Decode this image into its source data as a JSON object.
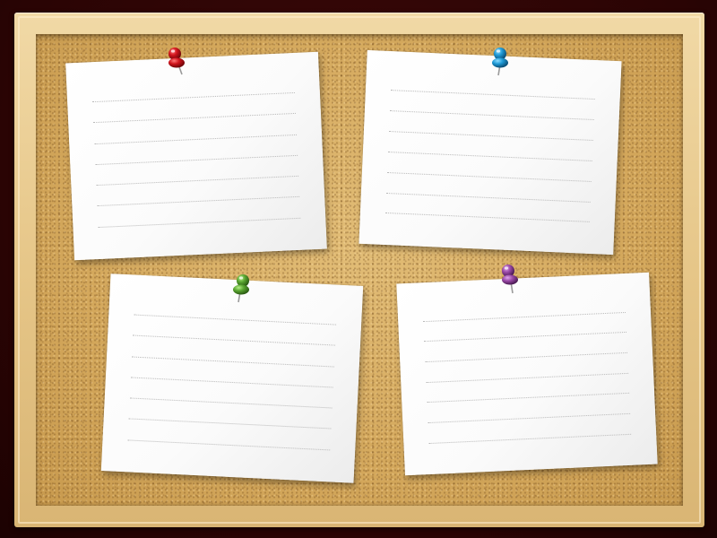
{
  "board": {
    "background_color": "#2a0505",
    "frame_color": "#e6c688",
    "cork_color": "#d7ab5f"
  },
  "notes": [
    {
      "pin_icon": "red-pushpin-icon",
      "pin_color": "#d0141c",
      "lines": 7
    },
    {
      "pin_icon": "blue-pushpin-icon",
      "pin_color": "#1f9ad6",
      "lines": 7
    },
    {
      "pin_icon": "green-pushpin-icon",
      "pin_color": "#5aa632",
      "lines": 7
    },
    {
      "pin_icon": "purple-pushpin-icon",
      "pin_color": "#9b4aa8",
      "lines": 7
    }
  ]
}
